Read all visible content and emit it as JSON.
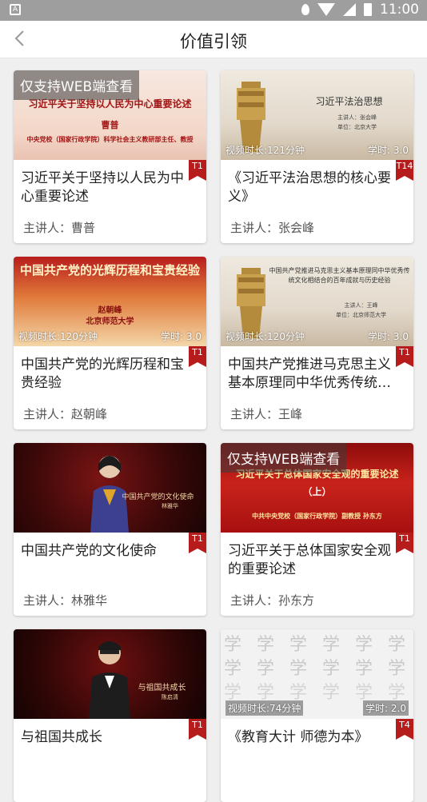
{
  "status": {
    "time": "11:00",
    "left_icon": "A"
  },
  "header": {
    "title": "价值引领"
  },
  "labels": {
    "speaker_prefix": "主讲人："
  },
  "cards": [
    {
      "web_only": "仅支持WEB端查看",
      "thumb_title": "习近平关于坚持以人民为中心重要论述",
      "thumb_sub": "曹普",
      "thumb_sub2": "中央党校（国家行政学院）科学社会主义教研部主任、教授",
      "tag": "T1",
      "title": "习近平关于坚持以人民为中心重要论述",
      "speaker": "主讲人：曹普"
    },
    {
      "thumb_title": "习近平法治思想",
      "thumb_sub": "主讲人：张会峰",
      "thumb_sub2": "单位：北京大学",
      "duration": "视频时长:121分钟",
      "hours": "学时: 3.0",
      "tag": "T14",
      "title": "《习近平法治思想的核心要义》",
      "speaker": "主讲人：张会峰"
    },
    {
      "thumb_title": "中国共产党的光辉历程和宝贵经验",
      "thumb_sub": "赵朝峰",
      "thumb_sub2": "北京师范大学",
      "duration": "视频时长:120分钟",
      "hours": "学时: 3.0",
      "tag": "T1",
      "title": "中国共产党的光辉历程和宝贵经验",
      "speaker": "主讲人：赵朝峰"
    },
    {
      "thumb_title": "中国共产党推进马克思主义基本原理同中华优秀传统文化相结合的百年成就与历史经验",
      "thumb_sub": "主讲人：王峰",
      "thumb_sub2": "单位：北京师范大学",
      "duration": "视频时长:120分钟",
      "hours": "学时: 3.0",
      "tag": "T1",
      "title": "中国共产党推进马克思主义基本原理同中华优秀传统…",
      "speaker": "主讲人：王峰"
    },
    {
      "thumb_title": "中国共产党的文化使命",
      "thumb_sub": "林雅华",
      "tag": "T1",
      "title": "中国共产党的文化使命",
      "speaker": "主讲人：林雅华"
    },
    {
      "web_only": "仅支持WEB端查看",
      "thumb_title": "习近平关于总体国家安全观的重要论述",
      "thumb_sub": "（上）",
      "thumb_sub2": "中共中央党校（国家行政学院）副教授 孙东方",
      "tag": "T1",
      "title": "习近平关于总体国家安全观的重要论述",
      "speaker": "主讲人：孙东方"
    },
    {
      "thumb_title": "与祖国共成长",
      "thumb_sub": "陈启清",
      "tag": "T1",
      "title": "与祖国共成长",
      "speaker": ""
    },
    {
      "thumb_title": "学 学 学 学 学 学",
      "duration": "视频时长:74分钟",
      "hours": "学时: 2.0",
      "tag": "T4",
      "title": "《教育大计 师德为本》",
      "speaker": ""
    }
  ]
}
